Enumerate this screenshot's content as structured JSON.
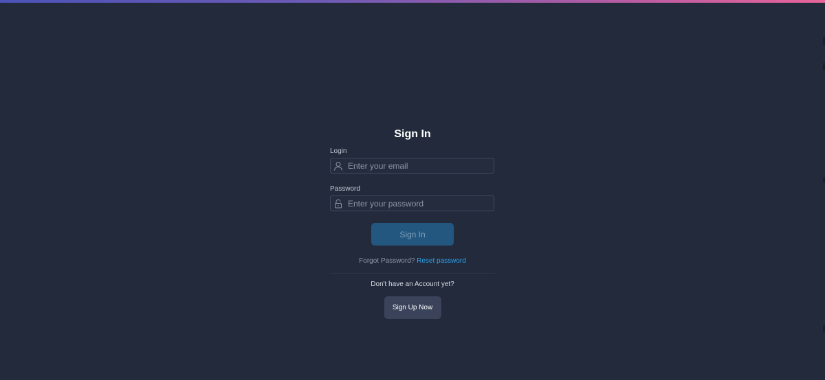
{
  "form": {
    "title": "Sign In",
    "login_label": "Login",
    "email_placeholder": "Enter your email",
    "password_label": "Password",
    "password_placeholder": "Enter your password",
    "signin_button": "Sign In",
    "forgot_text": "Forgot Password?",
    "reset_link": "Reset password",
    "no_account_text": "Don't have an Account yet?",
    "signup_button": "Sign Up Now"
  },
  "icons": {
    "email_field": "user-icon",
    "password_field": "lock-icon"
  },
  "colors": {
    "background": "#222a3b",
    "link": "#2ea2ee",
    "primary_button": "#24577f",
    "secondary_button": "#3a435a",
    "top_bar_gradient": [
      "#4c53b8",
      "#e9649a"
    ]
  }
}
